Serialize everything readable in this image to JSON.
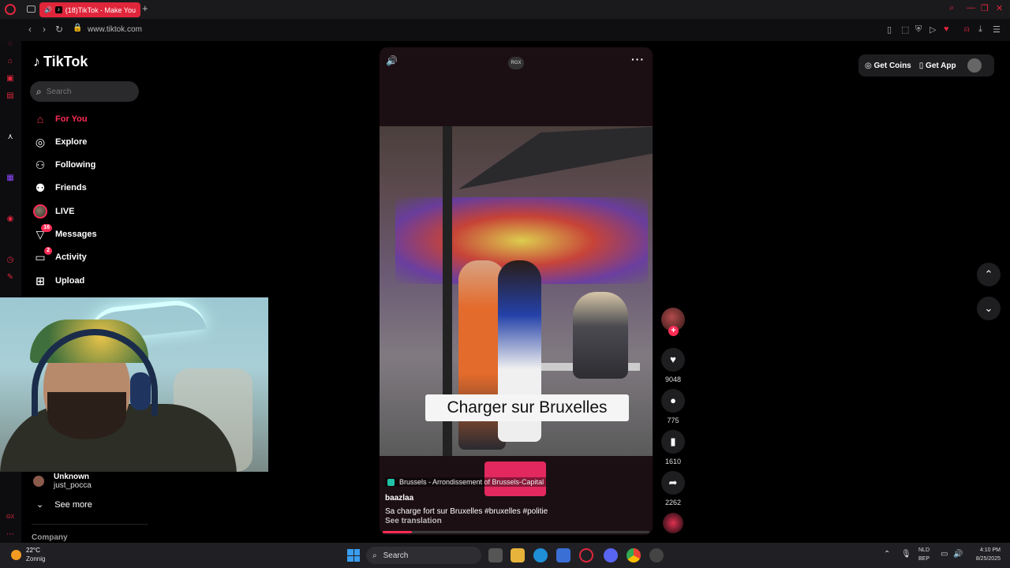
{
  "browser": {
    "tab_title": "(18)TikTok - Make You",
    "tab_favicon": "tiktok-icon",
    "url": "www.tiktok.com",
    "accent_color": "#e0263b"
  },
  "tiktok": {
    "logo_text": "TikTok",
    "search_placeholder": "Search",
    "nav": [
      {
        "label": "For You",
        "icon": "home-icon",
        "active": true
      },
      {
        "label": "Explore",
        "icon": "compass-icon"
      },
      {
        "label": "Following",
        "icon": "person-plus-icon"
      },
      {
        "label": "Friends",
        "icon": "people-icon"
      },
      {
        "label": "LIVE",
        "icon": "live-avatar"
      },
      {
        "label": "Messages",
        "icon": "send-icon",
        "badge": "16"
      },
      {
        "label": "Activity",
        "icon": "chat-icon",
        "badge": "2"
      },
      {
        "label": "Upload",
        "icon": "plus-square-icon"
      }
    ],
    "following_list": [
      {
        "name": "Unknown",
        "handle": "just_pocca"
      }
    ],
    "see_more": "See more",
    "footer_section": "Company",
    "top_right": {
      "coins_label": "Get Coins",
      "app_label": "Get App"
    },
    "brand_color": "#fe2c55"
  },
  "video": {
    "badge": "RGX",
    "caption": "Charger sur Bruxelles",
    "location": "Brussels - Arrondissement of Brussels-Capital",
    "author": "baazlaa",
    "description": "Sa charge fort sur Bruxelles #bruxelles  #politie",
    "see_translation": "See translation",
    "progress": 0.11,
    "stats": {
      "likes": "9048",
      "comments": "775",
      "saves": "1610",
      "shares": "2262"
    }
  },
  "taskbar": {
    "weather_temp": "22°C",
    "weather_desc": "Zonnig",
    "search_label": "Search",
    "lang_1": "NLD",
    "lang_2": "BEP",
    "time": "4:10 PM",
    "date": "8/25/2025"
  }
}
